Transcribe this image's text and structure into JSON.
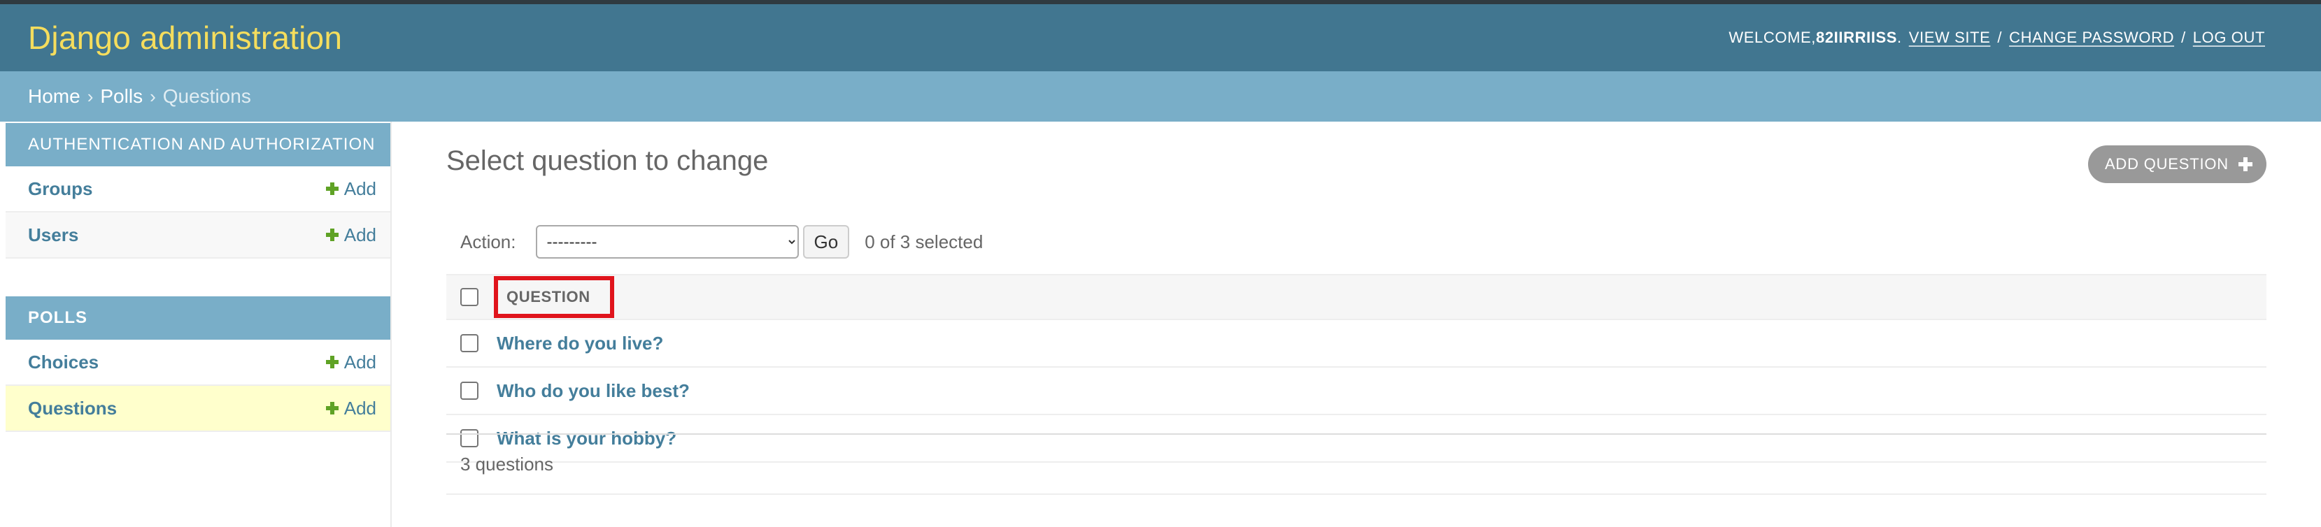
{
  "header": {
    "site_name": "Django administration",
    "welcome": "WELCOME, ",
    "username": "82IIRRIISS",
    "after_username": ".",
    "view_site": "VIEW SITE",
    "change_password": "CHANGE PASSWORD",
    "log_out": "LOG OUT",
    "separator": "/"
  },
  "breadcrumbs": {
    "home": "Home",
    "polls": "Polls",
    "current": "Questions",
    "separator": "›"
  },
  "sidebar": {
    "auth_caption": "AUTHENTICATION AND AUTHORIZATION",
    "polls_caption": "POLLS",
    "add_label": "Add",
    "auth_models": [
      "Groups",
      "Users"
    ],
    "polls_models": [
      "Choices",
      "Questions"
    ]
  },
  "content": {
    "title": "Select question to change",
    "add_button": "ADD QUESTION",
    "action_label": "Action:",
    "action_selected": "---------",
    "go_label": "Go",
    "selected_count": "0 of 3 selected",
    "column_header": "QUESTION",
    "questions": [
      "Where do you live?",
      "Who do you like best?",
      "What is your hobby?"
    ],
    "result_count": "3 questions"
  },
  "colors": {
    "header_bg": "#417690",
    "breadcrumb_bg": "#79aec8",
    "branding": "#f5dd5d",
    "link": "#447e9b",
    "highlight_border": "#e0141c",
    "current_row_bg": "#ffffcc",
    "add_green": "#5fa225"
  }
}
